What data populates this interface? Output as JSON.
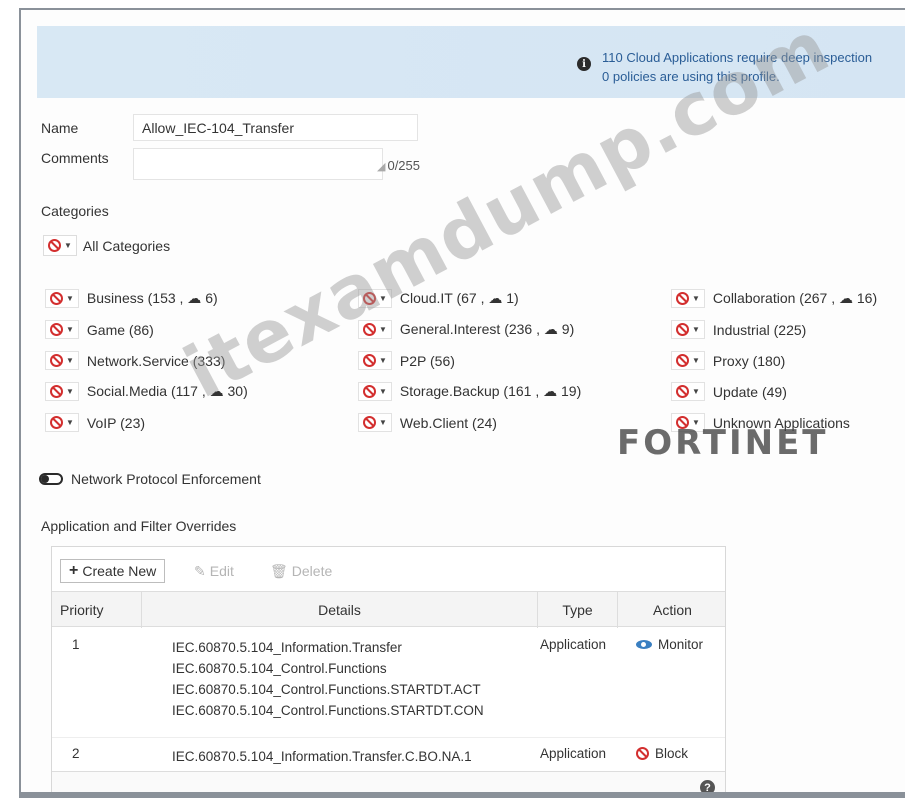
{
  "banner": {
    "line1": "110 Cloud Applications require deep inspection",
    "line2": "0 policies are using this profile."
  },
  "form": {
    "name_label": "Name",
    "name_value": "Allow_IEC-104_Transfer",
    "comments_label": "Comments",
    "comments_counter": "0/255"
  },
  "categories": {
    "title": "Categories",
    "all_label": "All Categories",
    "items": [
      {
        "label": "Business (153 , ☁ 6)"
      },
      {
        "label": "Cloud.IT (67 , ☁ 1)"
      },
      {
        "label": "Collaboration (267 , ☁ 16)"
      },
      {
        "label": "Game (86)"
      },
      {
        "label": "General.Interest (236 , ☁ 9)"
      },
      {
        "label": "Industrial (225)"
      },
      {
        "label": "Network.Service (333)"
      },
      {
        "label": "P2P (56)"
      },
      {
        "label": "Proxy (180)"
      },
      {
        "label": "Social.Media (117 , ☁ 30)"
      },
      {
        "label": "Storage.Backup (161 , ☁ 19)"
      },
      {
        "label": "Update (49)"
      },
      {
        "label": "VoIP (23)"
      },
      {
        "label": "Web.Client (24)"
      },
      {
        "label": "Unknown Applications"
      }
    ]
  },
  "protocol": {
    "label": "Network Protocol Enforcement"
  },
  "overrides": {
    "title": "Application and Filter Overrides",
    "toolbar": {
      "create": "Create New",
      "edit": "Edit",
      "delete": "Delete"
    },
    "columns": {
      "priority": "Priority",
      "details": "Details",
      "type": "Type",
      "action": "Action"
    },
    "rows": [
      {
        "priority": "1",
        "details": [
          "IEC.60870.5.104_Information.Transfer",
          "IEC.60870.5.104_Control.Functions",
          "IEC.60870.5.104_Control.Functions.STARTDT.ACT",
          "IEC.60870.5.104_Control.Functions.STARTDT.CON"
        ],
        "type": "Application",
        "action": "Monitor"
      },
      {
        "priority": "2",
        "details": [
          "IEC.60870.5.104_Information.Transfer.C.BO.NA.1"
        ],
        "type": "Application",
        "action": "Block"
      }
    ]
  },
  "watermark": "itexamdump.com",
  "brand_logo": "FORTINET",
  "colors": {
    "block_red": "#d32f2f",
    "banner_bg": "#d8e8f4",
    "link_blue": "#2a5d96",
    "monitor_blue": "#3a7fc1"
  },
  "icons": [
    "info-icon",
    "block-icon",
    "cloud-icon",
    "toggle-icon",
    "plus-icon",
    "edit-icon",
    "trash-icon",
    "eye-icon",
    "help-icon",
    "resize-icon"
  ]
}
